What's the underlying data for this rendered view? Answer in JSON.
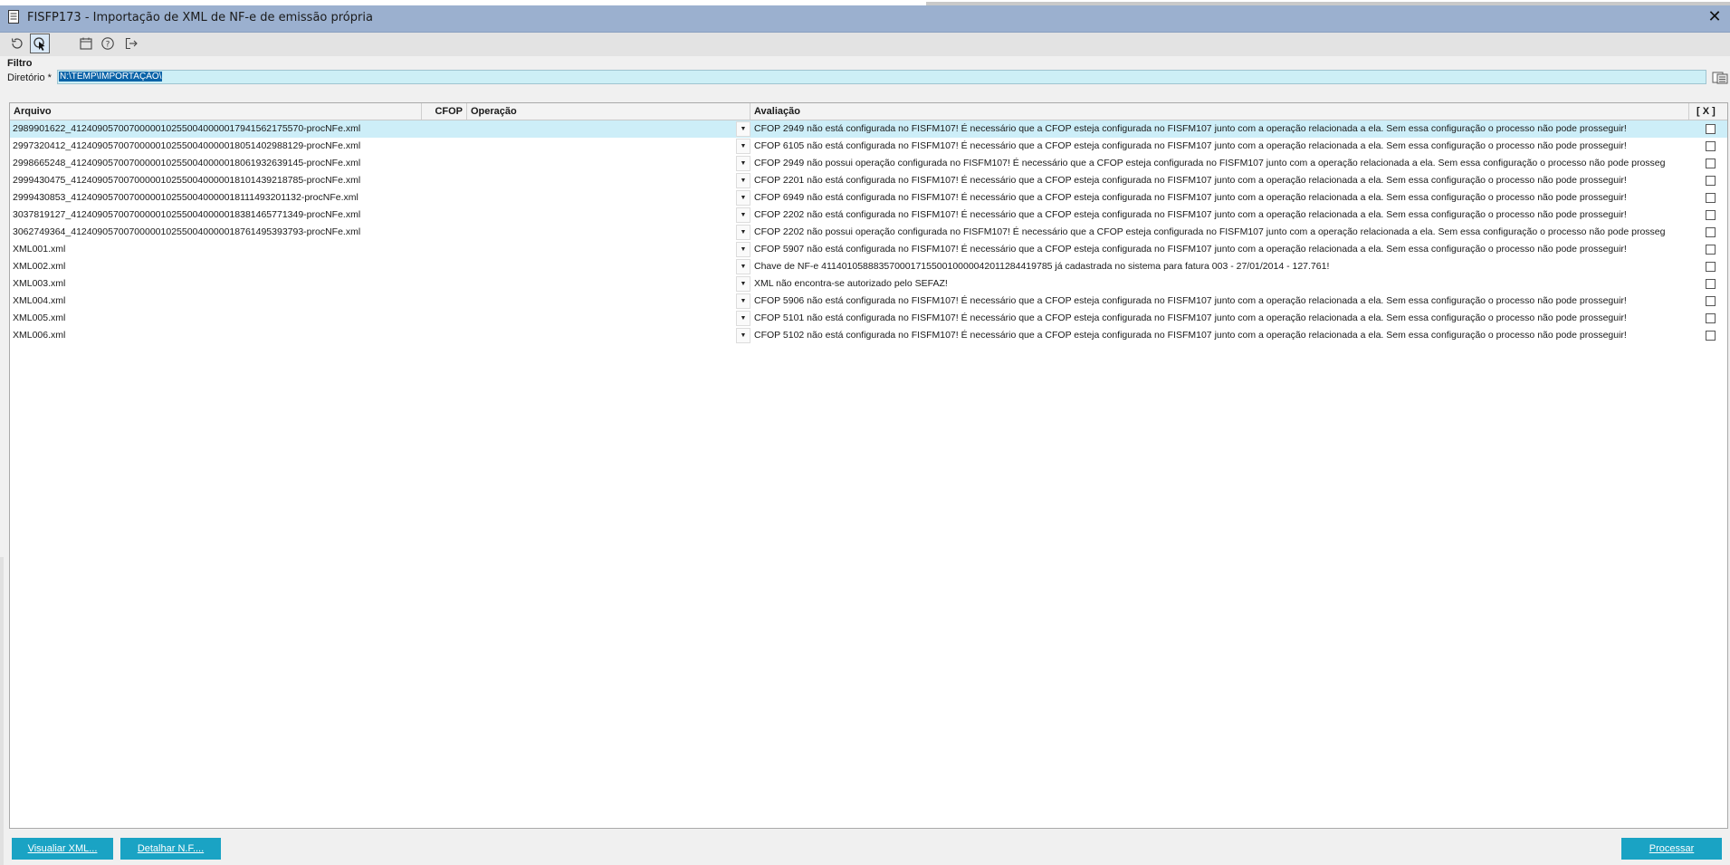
{
  "window": {
    "title": "FISFP173 - Importação de XML de NF-e de emissão própria",
    "close_label": "✕"
  },
  "toolbar": {
    "icons": [
      "refresh-icon",
      "search-icon",
      "calendar-icon",
      "help-icon",
      "exit-icon"
    ]
  },
  "filter": {
    "section_label": "Filtro",
    "directory_label": "Diretório *",
    "directory_value": "N:\\TEMP\\IMPORTAÇÃO\\"
  },
  "grid": {
    "columns": {
      "arquivo": "Arquivo",
      "cfop": "CFOP",
      "operacao": "Operação",
      "avaliacao": "Avaliação",
      "check": "[ X ]"
    },
    "rows": [
      {
        "arquivo": "2989901622_41240905700700000102550040000017941562175570-procNFe.xml",
        "cfop": "",
        "operacao": "",
        "avaliacao": "CFOP 2949 não está configurada no FISFM107! É necessário que a CFOP esteja configurada no FISFM107 junto com a operação relacionada a ela. Sem essa configuração o processo não pode prosseguir!",
        "checked": false
      },
      {
        "arquivo": "2997320412_41240905700700000102550040000018051402988129-procNFe.xml",
        "cfop": "",
        "operacao": "",
        "avaliacao": "CFOP 6105 não está configurada no FISFM107! É necessário que a CFOP esteja configurada no FISFM107 junto com a operação relacionada a ela. Sem essa configuração o processo não pode prosseguir!",
        "checked": false
      },
      {
        "arquivo": "2998665248_41240905700700000102550040000018061932639145-procNFe.xml",
        "cfop": "",
        "operacao": "",
        "avaliacao": "CFOP 2949 não possui operação configurada no FISFM107! É necessário que a CFOP esteja configurada no FISFM107 junto com a operação relacionada a ela. Sem essa configuração o processo não pode prosseg",
        "checked": false
      },
      {
        "arquivo": "2999430475_41240905700700000102550040000018101439218785-procNFe.xml",
        "cfop": "",
        "operacao": "",
        "avaliacao": "CFOP 2201 não está configurada no FISFM107! É necessário que a CFOP esteja configurada no FISFM107 junto com a operação relacionada a ela. Sem essa configuração o processo não pode prosseguir!",
        "checked": false
      },
      {
        "arquivo": "2999430853_41240905700700000102550040000018111493201132-procNFe.xml",
        "cfop": "",
        "operacao": "",
        "avaliacao": "CFOP 6949 não está configurada no FISFM107! É necessário que a CFOP esteja configurada no FISFM107 junto com a operação relacionada a ela. Sem essa configuração o processo não pode prosseguir!",
        "checked": false
      },
      {
        "arquivo": "3037819127_41240905700700000102550040000018381465771349-procNFe.xml",
        "cfop": "",
        "operacao": "",
        "avaliacao": "CFOP 2202 não está configurada no FISFM107! É necessário que a CFOP esteja configurada no FISFM107 junto com a operação relacionada a ela. Sem essa configuração o processo não pode prosseguir!",
        "checked": false
      },
      {
        "arquivo": "3062749364_41240905700700000102550040000018761495393793-procNFe.xml",
        "cfop": "",
        "operacao": "",
        "avaliacao": "CFOP 2202 não possui operação configurada no FISFM107! É necessário que a CFOP esteja configurada no FISFM107 junto com a operação relacionada a ela. Sem essa configuração o processo não pode prosseg",
        "checked": false
      },
      {
        "arquivo": "XML001.xml",
        "cfop": "",
        "operacao": "",
        "avaliacao": "CFOP 5907 não está configurada no FISFM107! É necessário que a CFOP esteja configurada no FISFM107 junto com a operação relacionada a ela. Sem essa configuração o processo não pode prosseguir!",
        "checked": false
      },
      {
        "arquivo": "XML002.xml",
        "cfop": "",
        "operacao": "",
        "avaliacao": "Chave de NF-e 41140105888357000171550010000042011284419785 já cadastrada no sistema para fatura 003 - 27/01/2014 - 127.761!",
        "checked": false
      },
      {
        "arquivo": "XML003.xml",
        "cfop": "",
        "operacao": "",
        "avaliacao": "XML não encontra-se autorizado pelo SEFAZ!",
        "checked": false
      },
      {
        "arquivo": "XML004.xml",
        "cfop": "",
        "operacao": "",
        "avaliacao": "CFOP 5906 não está configurada no FISFM107! É necessário que a CFOP esteja configurada no FISFM107 junto com a operação relacionada a ela. Sem essa configuração o processo não pode prosseguir!",
        "checked": false
      },
      {
        "arquivo": "XML005.xml",
        "cfop": "",
        "operacao": "",
        "avaliacao": "CFOP 5101 não está configurada no FISFM107! É necessário que a CFOP esteja configurada no FISFM107 junto com a operação relacionada a ela. Sem essa configuração o processo não pode prosseguir!",
        "checked": false
      },
      {
        "arquivo": "XML006.xml",
        "cfop": "",
        "operacao": "",
        "avaliacao": "CFOP 5102 não está configurada no FISFM107! É necessário que a CFOP esteja configurada no FISFM107 junto com a operação relacionada a ela. Sem essa configuração o processo não pode prosseguir!",
        "checked": false
      }
    ]
  },
  "buttons": {
    "visualizar": "Visualiar XML...",
    "detalhar": "Detalhar N.F....",
    "processar": "Processar"
  },
  "colors": {
    "title_bar": "#9bb0cf",
    "selected_row": "#cdeef8",
    "button": "#1aa3c4"
  }
}
